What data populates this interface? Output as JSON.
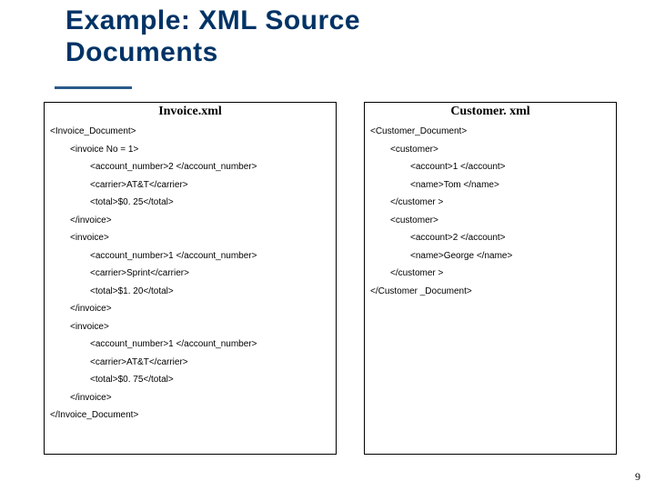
{
  "title_line1": "Example: XML Source",
  "title_line2": "Documents",
  "page_number": "9",
  "left": {
    "header": "Invoice.xml",
    "lines": [
      {
        "indent": 0,
        "text": "<Invoice_Document>"
      },
      {
        "indent": 1,
        "text": "<invoice No = 1>"
      },
      {
        "indent": 2,
        "text": "<account_number>2 </account_number>"
      },
      {
        "indent": 2,
        "text": "<carrier>AT&T</carrier>"
      },
      {
        "indent": 2,
        "text": "<total>$0. 25</total>"
      },
      {
        "indent": 1,
        "text": "</invoice>"
      },
      {
        "indent": 1,
        "text": "<invoice>"
      },
      {
        "indent": 2,
        "text": "<account_number>1 </account_number>"
      },
      {
        "indent": 2,
        "text": "<carrier>Sprint</carrier>"
      },
      {
        "indent": 2,
        "text": "<total>$1. 20</total>"
      },
      {
        "indent": 1,
        "text": "</invoice>"
      },
      {
        "indent": 1,
        "text": "<invoice>"
      },
      {
        "indent": 2,
        "text": "<account_number>1 </account_number>"
      },
      {
        "indent": 2,
        "text": "<carrier>AT&T</carrier>"
      },
      {
        "indent": 2,
        "text": "<total>$0. 75</total>"
      },
      {
        "indent": 1,
        "text": "</invoice>"
      },
      {
        "indent": 0,
        "text": "</Invoice_Document>"
      }
    ]
  },
  "right": {
    "header": "Customer. xml",
    "lines": [
      {
        "indent": 0,
        "text": "<Customer_Document>"
      },
      {
        "indent": 1,
        "text": "<customer>"
      },
      {
        "indent": 2,
        "text": "<account>1 </account>"
      },
      {
        "indent": 2,
        "text": "<name>Tom </name>"
      },
      {
        "indent": 1,
        "text": "</customer >"
      },
      {
        "indent": 1,
        "text": "<customer>"
      },
      {
        "indent": 2,
        "text": "<account>2 </account>"
      },
      {
        "indent": 2,
        "text": "<name>George </name>"
      },
      {
        "indent": 1,
        "text": "</customer >"
      },
      {
        "indent": 0,
        "text": "</Customer _Document>"
      }
    ]
  }
}
